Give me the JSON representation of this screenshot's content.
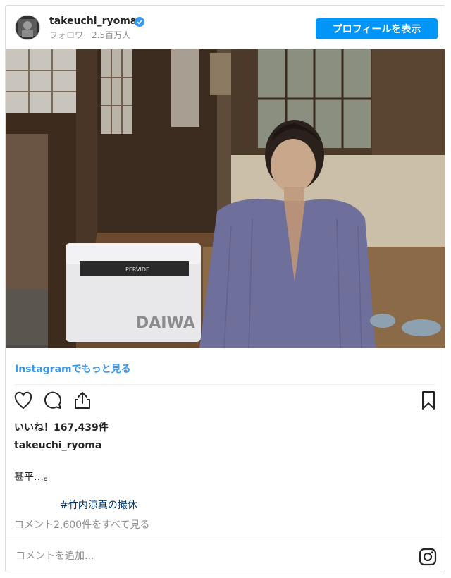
{
  "header": {
    "username": "takeuchi_ryoma",
    "followers": "フォロワー2.5百万人",
    "profile_button": "プロフィールを表示",
    "verified_icon": "verified-badge-icon"
  },
  "photo": {
    "cooler_brand": "DAIWA"
  },
  "more_link": "Instagramでもっと見る",
  "actions": {
    "like_icon": "heart-icon",
    "comment_icon": "comment-icon",
    "share_icon": "share-icon",
    "save_icon": "bookmark-icon"
  },
  "likes": "いいね！167,439件",
  "author": "takeuchi_ryoma",
  "caption": "甚平…。",
  "hashtag": "#竹内涼真の撮休",
  "view_comments": "コメント2,600件をすべて見る",
  "comment": {
    "placeholder": "コメントを追加...",
    "value": ""
  },
  "logo_icon": "instagram-icon",
  "colors": {
    "accent": "#0095f6",
    "link": "#3897f0",
    "hashtag": "#00376b",
    "muted": "#8e8e8e"
  }
}
